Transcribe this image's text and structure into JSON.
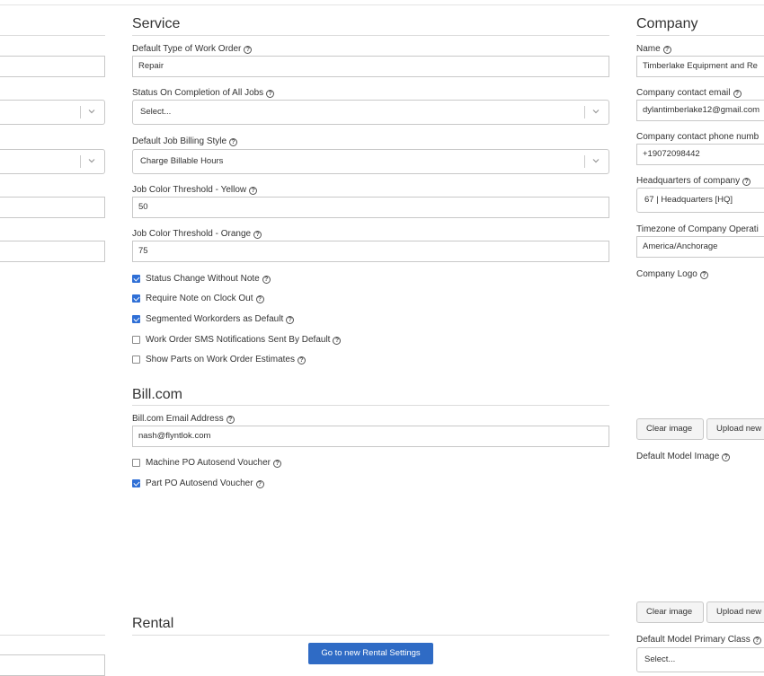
{
  "service": {
    "title": "Service",
    "default_type": {
      "label": "Default Type of Work Order",
      "value": "Repair"
    },
    "status_on_completion": {
      "label": "Status On Completion of All Jobs",
      "placeholder": "Select..."
    },
    "billing_style": {
      "label": "Default Job Billing Style",
      "value": "Charge Billable Hours"
    },
    "threshold_yellow": {
      "label": "Job Color Threshold - Yellow",
      "value": "50"
    },
    "threshold_orange": {
      "label": "Job Color Threshold - Orange",
      "value": "75"
    },
    "checkboxes": [
      {
        "label": "Status Change Without Note",
        "checked": true
      },
      {
        "label": "Require Note on Clock Out",
        "checked": true
      },
      {
        "label": "Segmented Workorders as Default",
        "checked": true
      },
      {
        "label": "Work Order SMS Notifications Sent By Default",
        "checked": false
      },
      {
        "label": "Show Parts on Work Order Estimates",
        "checked": false
      }
    ]
  },
  "billcom": {
    "title": "Bill.com",
    "email": {
      "label": "Bill.com Email Address",
      "value": "nash@flyntlok.com"
    },
    "checkboxes": [
      {
        "label": "Machine PO Autosend Voucher",
        "checked": false
      },
      {
        "label": "Part PO Autosend Voucher",
        "checked": true
      }
    ]
  },
  "rental": {
    "title": "Rental",
    "button_label": "Go to new Rental Settings"
  },
  "company": {
    "title": "Company",
    "name": {
      "label": "Name",
      "value": "Timberlake Equipment and Re"
    },
    "email": {
      "label": "Company contact email",
      "value": "dylantimberlake12@gmail.com"
    },
    "phone": {
      "label": "Company contact phone numb",
      "value": "+19072098442"
    },
    "hq": {
      "label": "Headquarters of company",
      "value": "67 | Headquarters [HQ]"
    },
    "timezone": {
      "label": "Timezone of Company Operati",
      "value": "America/Anchorage"
    },
    "logo": {
      "label": "Company Logo",
      "clear": "Clear image",
      "upload": "Upload new"
    },
    "model_image": {
      "label": "Default Model Image",
      "clear": "Clear image",
      "upload": "Upload new"
    },
    "primary_class": {
      "label": "Default Model Primary Class",
      "placeholder": "Select..."
    }
  },
  "help_glyph": "?",
  "colors": {
    "accent": "#2f6fd6",
    "button_primary": "#2f6bc5"
  }
}
